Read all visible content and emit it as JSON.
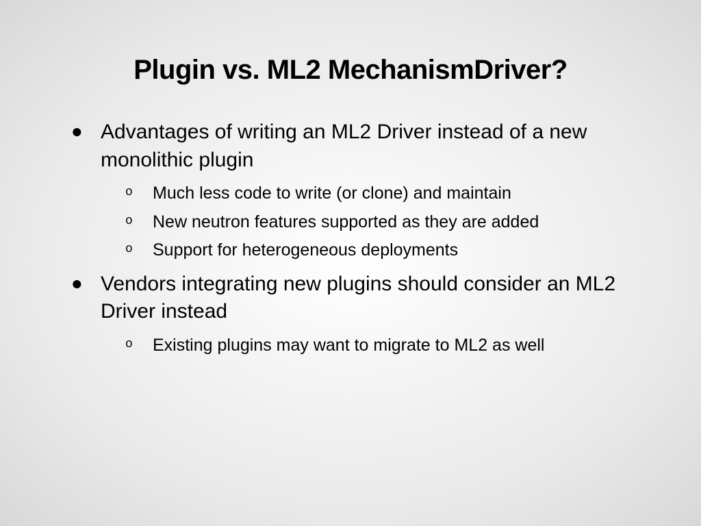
{
  "slide": {
    "title": "Plugin vs. ML2 MechanismDriver?",
    "bullets": [
      {
        "text": "Advantages of writing an ML2 Driver instead of a new monolithic plugin",
        "sub": [
          "Much less code to write (or clone) and maintain",
          "New neutron features supported as they are added",
          "Support for heterogeneous deployments"
        ]
      },
      {
        "text": "Vendors integrating new plugins should consider an ML2 Driver instead",
        "sub": [
          "Existing plugins may want to migrate to ML2 as well"
        ]
      }
    ]
  }
}
